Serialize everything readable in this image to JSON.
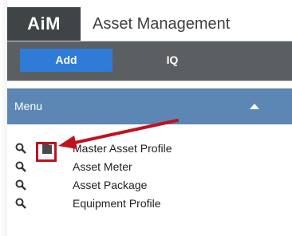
{
  "header": {
    "logo": "AiM",
    "title": "Asset Management"
  },
  "toolbar": {
    "add_label": "Add",
    "iq_label": "IQ"
  },
  "menu": {
    "label": "Menu",
    "toggle_icon": "chevron-up-icon",
    "items": [
      {
        "label": "Master Asset Profile",
        "icon": "search-icon",
        "extra_icon": "document-icon",
        "highlighted": true
      },
      {
        "label": "Asset Meter",
        "icon": "search-icon"
      },
      {
        "label": "Asset Package",
        "icon": "search-icon"
      },
      {
        "label": "Equipment Profile",
        "icon": "search-icon"
      }
    ]
  },
  "annotation": {
    "color": "#c0121c"
  },
  "colors": {
    "logo_bg": "#3f4447",
    "toolbar_bg": "#5b5f61",
    "add_button": "#2f7bd8",
    "menu_bar": "#5c87b5"
  }
}
